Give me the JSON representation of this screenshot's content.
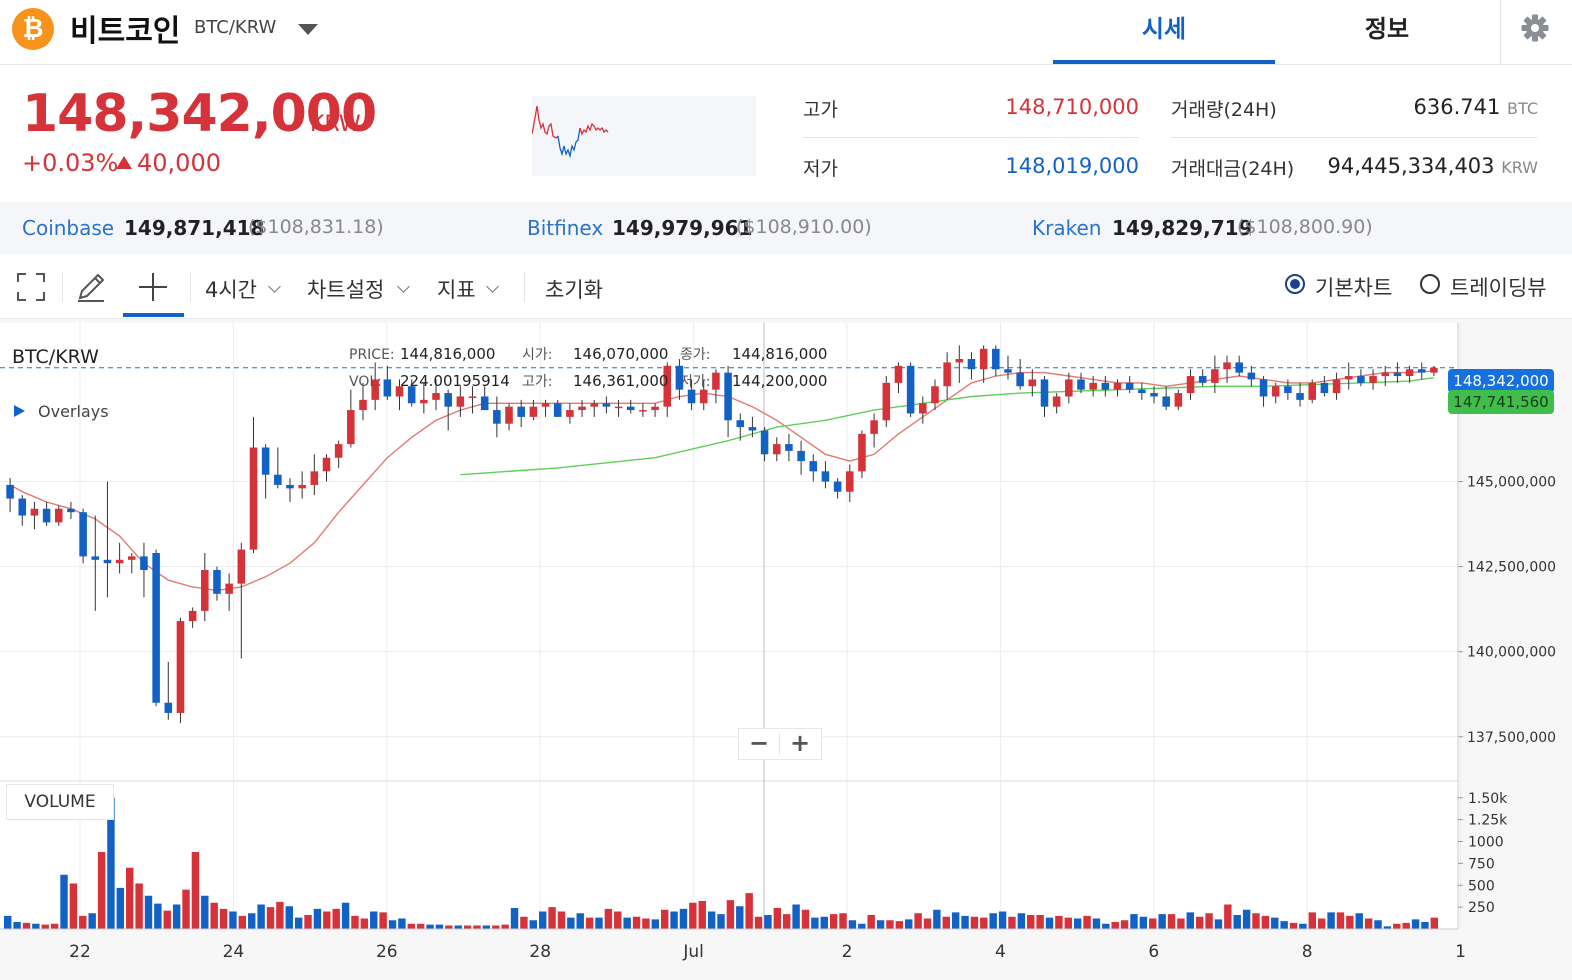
{
  "header": {
    "coin_symbol": "₿",
    "coin_name": "비트코인",
    "pair": "BTC/KRW",
    "tabs": [
      {
        "label": "시세",
        "active": true
      },
      {
        "label": "정보",
        "active": false
      }
    ],
    "settings_icon": "gear-icon"
  },
  "summary": {
    "price": "148,342,000",
    "unit": "KRW",
    "change_pct": "+0.03%",
    "change_abs": "40,000",
    "up_color": "#d6323a",
    "down_color": "#1261c4",
    "high_label": "고가",
    "high_value": "148,710,000",
    "low_label": "저가",
    "low_value": "148,019,000",
    "volume_label": "거래량(24H)",
    "volume_value": "636.741",
    "volume_unit": "BTC",
    "amount_label": "거래대금(24H)",
    "amount_value": "94,445,334,403",
    "amount_unit": "KRW"
  },
  "exchanges": [
    {
      "name": "Coinbase",
      "krw": "149,871,418",
      "usd": "($108,831.18)"
    },
    {
      "name": "Bitfinex",
      "krw": "149,979,961",
      "usd": "($108,910.00)"
    },
    {
      "name": "Kraken",
      "krw": "149,829,719",
      "usd": "($108,800.90)"
    }
  ],
  "toolbar": {
    "interval": "4시간",
    "chart_settings": "차트설정",
    "indicators": "지표",
    "reset": "초기화",
    "mode_basic": "기본차트",
    "mode_trading": "트레이딩뷰"
  },
  "chart_info": {
    "symbol": "BTC/KRW",
    "overlays": "Overlays",
    "price_label": "PRICE:",
    "price_value": "144,816,000",
    "open_label": "시가:",
    "open_value": "146,070,000",
    "close_label": "종가:",
    "close_value": "144,816,000",
    "vol_label": "VOL:",
    "vol_value": "224.00195914",
    "high_label": "고가:",
    "high_value": "146,361,000",
    "low_label": "저가:",
    "low_value": "144,200,000",
    "current_tag": "148,342,000",
    "ma_tag": "147,741,560",
    "volume_title": "VOLUME",
    "zoom_out": "−",
    "zoom_in": "+"
  },
  "chart_data": {
    "type": "candlestick",
    "price_axis": [
      145000000,
      142500000,
      140000000,
      137500000
    ],
    "price_axis_labels": [
      "145,000,000",
      "142,500,000",
      "140,000,000",
      "137,500,000"
    ],
    "volume_axis_labels": [
      "1.50k",
      "1.25k",
      "1000",
      "750",
      "500",
      "250"
    ],
    "x_axis_labels": [
      "22",
      "24",
      "26",
      "28",
      "Jul",
      "2",
      "4",
      "6",
      "8",
      "1"
    ],
    "ylim": [
      136200000,
      149600000
    ],
    "candles": [
      [
        144900000,
        145100000,
        144100000,
        144500000
      ],
      [
        144500000,
        144600000,
        143700000,
        144000000
      ],
      [
        144000000,
        144400000,
        143600000,
        144200000
      ],
      [
        144200000,
        144400000,
        143700000,
        143800000
      ],
      [
        143800000,
        144300000,
        143700000,
        144200000
      ],
      [
        144200000,
        144400000,
        143900000,
        144100000
      ],
      [
        144100000,
        144200000,
        142600000,
        142800000
      ],
      [
        142800000,
        144000000,
        141200000,
        142700000
      ],
      [
        142700000,
        145000000,
        141600000,
        142600000
      ],
      [
        142600000,
        143200000,
        142300000,
        142700000
      ],
      [
        142700000,
        142900000,
        142300000,
        142800000
      ],
      [
        142800000,
        143200000,
        141600000,
        142400000
      ],
      [
        142900000,
        143000000,
        138400000,
        138500000
      ],
      [
        138500000,
        139700000,
        138000000,
        138200000
      ],
      [
        138200000,
        141000000,
        137900000,
        140900000
      ],
      [
        140900000,
        141300000,
        140700000,
        141200000
      ],
      [
        141200000,
        142900000,
        140900000,
        142400000
      ],
      [
        142400000,
        142500000,
        141500000,
        141700000
      ],
      [
        141700000,
        142300000,
        141200000,
        142000000
      ],
      [
        142000000,
        143200000,
        139800000,
        143000000
      ],
      [
        143000000,
        146900000,
        142900000,
        146000000
      ],
      [
        146000000,
        146100000,
        144500000,
        145200000
      ],
      [
        145200000,
        146000000,
        144800000,
        144900000
      ],
      [
        144900000,
        145100000,
        144400000,
        144800000
      ],
      [
        144800000,
        145300000,
        144500000,
        144900000
      ],
      [
        144900000,
        145800000,
        144600000,
        145300000
      ],
      [
        145300000,
        145800000,
        145000000,
        145700000
      ],
      [
        145700000,
        146200000,
        145400000,
        146100000
      ],
      [
        146100000,
        147700000,
        146000000,
        147100000
      ],
      [
        147100000,
        147900000,
        146800000,
        147400000
      ],
      [
        147400000,
        148500000,
        147100000,
        148000000
      ],
      [
        148000000,
        148400000,
        147400000,
        147500000
      ],
      [
        147500000,
        148000000,
        147100000,
        147800000
      ],
      [
        147800000,
        148000000,
        147200000,
        147300000
      ],
      [
        147300000,
        147900000,
        147000000,
        147400000
      ],
      [
        147400000,
        148000000,
        147100000,
        147600000
      ],
      [
        147600000,
        147700000,
        146500000,
        147200000
      ],
      [
        147200000,
        147800000,
        146900000,
        147500000
      ],
      [
        147500000,
        147800000,
        147000000,
        147500000
      ],
      [
        147500000,
        147800000,
        147100000,
        147100000
      ],
      [
        147100000,
        147500000,
        146300000,
        146700000
      ],
      [
        146700000,
        147300000,
        146500000,
        147200000
      ],
      [
        147200000,
        147400000,
        146600000,
        146900000
      ],
      [
        146900000,
        147400000,
        146800000,
        147200000
      ],
      [
        147200000,
        147400000,
        146900000,
        147300000
      ],
      [
        147300000,
        147400000,
        146900000,
        146900000
      ],
      [
        146900000,
        147300000,
        146700000,
        147100000
      ],
      [
        147100000,
        147400000,
        146900000,
        147200000
      ],
      [
        147200000,
        147400000,
        146900000,
        147300000
      ],
      [
        147300000,
        147500000,
        147000000,
        147200000
      ],
      [
        147200000,
        147400000,
        146900000,
        147200000
      ],
      [
        147200000,
        147400000,
        147000000,
        147100000
      ],
      [
        147100000,
        147300000,
        146900000,
        147100000
      ],
      [
        147100000,
        147300000,
        146900000,
        147200000
      ],
      [
        147200000,
        148500000,
        146900000,
        148400000
      ],
      [
        148400000,
        148600000,
        147400000,
        147700000
      ],
      [
        147700000,
        148000000,
        147100000,
        147300000
      ],
      [
        147300000,
        148000000,
        147100000,
        147700000
      ],
      [
        147700000,
        148300000,
        147300000,
        148200000
      ],
      [
        148200000,
        148400000,
        146300000,
        146800000
      ],
      [
        146800000,
        147000000,
        146200000,
        146600000
      ],
      [
        146600000,
        146900000,
        146300000,
        146500000
      ],
      [
        146500000,
        146600000,
        145600000,
        145800000
      ],
      [
        145800000,
        146300000,
        145600000,
        146100000
      ],
      [
        146100000,
        146400000,
        145600000,
        145900000
      ],
      [
        145900000,
        146200000,
        145200000,
        145600000
      ],
      [
        145600000,
        145800000,
        145000000,
        145300000
      ],
      [
        145300000,
        145600000,
        144800000,
        145000000
      ],
      [
        145000000,
        145100000,
        144500000,
        144700000
      ],
      [
        144700000,
        145500000,
        144400000,
        145300000
      ],
      [
        145300000,
        146500000,
        145100000,
        146400000
      ],
      [
        146400000,
        147000000,
        146000000,
        146800000
      ],
      [
        146800000,
        148100000,
        146600000,
        147900000
      ],
      [
        147900000,
        148500000,
        147600000,
        148400000
      ],
      [
        148400000,
        148500000,
        146900000,
        147000000
      ],
      [
        147000000,
        147500000,
        146700000,
        147300000
      ],
      [
        147300000,
        148000000,
        147100000,
        147800000
      ],
      [
        147800000,
        148800000,
        147400000,
        148500000
      ],
      [
        148500000,
        149000000,
        147900000,
        148600000
      ],
      [
        148600000,
        148800000,
        148000000,
        148300000
      ],
      [
        148300000,
        149000000,
        147900000,
        148900000
      ],
      [
        148900000,
        149000000,
        148100000,
        148300000
      ],
      [
        148300000,
        148700000,
        148000000,
        148200000
      ],
      [
        148200000,
        148600000,
        147700000,
        147800000
      ],
      [
        147800000,
        148300000,
        147500000,
        148000000
      ],
      [
        148000000,
        148100000,
        146900000,
        147200000
      ],
      [
        147200000,
        147600000,
        147000000,
        147500000
      ],
      [
        147500000,
        148200000,
        147300000,
        148000000
      ],
      [
        148000000,
        148200000,
        147600000,
        147700000
      ],
      [
        147700000,
        148100000,
        147500000,
        147900000
      ],
      [
        147900000,
        148100000,
        147500000,
        147700000
      ],
      [
        147700000,
        148000000,
        147500000,
        147900000
      ],
      [
        147900000,
        148100000,
        147600000,
        147700000
      ],
      [
        147700000,
        147900000,
        147400000,
        147600000
      ],
      [
        147600000,
        147800000,
        147300000,
        147500000
      ],
      [
        147500000,
        147800000,
        147100000,
        147200000
      ],
      [
        147200000,
        147700000,
        147100000,
        147600000
      ],
      [
        147600000,
        148300000,
        147400000,
        148100000
      ],
      [
        148100000,
        148300000,
        147800000,
        147900000
      ],
      [
        147900000,
        148700000,
        147600000,
        148300000
      ],
      [
        148300000,
        148700000,
        147900000,
        148500000
      ],
      [
        148500000,
        148700000,
        148100000,
        148200000
      ],
      [
        148200000,
        148400000,
        147800000,
        148000000
      ],
      [
        148000000,
        148100000,
        147200000,
        147500000
      ],
      [
        147500000,
        147900000,
        147300000,
        147800000
      ],
      [
        147800000,
        148000000,
        147400000,
        147600000
      ],
      [
        147600000,
        147900000,
        147200000,
        147400000
      ],
      [
        147400000,
        148000000,
        147300000,
        147900000
      ],
      [
        147900000,
        148100000,
        147500000,
        147600000
      ],
      [
        147600000,
        148200000,
        147400000,
        148000000
      ],
      [
        148000000,
        148500000,
        147700000,
        148100000
      ],
      [
        148100000,
        148300000,
        147800000,
        147900000
      ],
      [
        147900000,
        148300000,
        147700000,
        148100000
      ],
      [
        148100000,
        148400000,
        147800000,
        148200000
      ],
      [
        148200000,
        148500000,
        147900000,
        148100000
      ],
      [
        148100000,
        148400000,
        147900000,
        148300000
      ],
      [
        148300000,
        148500000,
        148000000,
        148200000
      ],
      [
        148200000,
        148400000,
        148100000,
        148340000
      ]
    ],
    "volumes": [
      150,
      80,
      70,
      60,
      50,
      60,
      620,
      520,
      150,
      180,
      880,
      1500,
      470,
      700,
      520,
      380,
      290,
      210,
      280,
      450,
      880,
      380,
      300,
      230,
      200,
      150,
      180,
      280,
      250,
      310,
      260,
      130,
      160,
      230,
      200,
      230,
      300,
      150,
      120,
      200,
      190,
      100,
      120,
      60,
      60,
      50,
      50,
      40,
      40,
      40,
      40,
      40,
      40,
      50,
      240,
      140,
      100,
      200,
      250,
      200,
      130,
      180,
      130,
      130,
      230,
      200,
      130,
      140,
      120,
      110,
      220,
      200,
      230,
      300,
      320,
      200,
      170,
      330,
      260,
      410,
      140,
      160,
      240,
      170,
      280,
      220,
      130,
      140,
      170,
      180,
      100,
      60,
      160,
      100,
      100,
      90,
      110,
      180,
      120,
      220,
      140,
      190,
      150,
      140,
      130,
      180,
      200,
      140,
      180,
      160,
      160,
      130,
      150,
      130,
      120,
      150,
      120,
      60,
      80,
      100,
      170,
      140,
      120,
      170,
      170,
      120,
      190,
      140,
      180,
      110,
      280,
      160,
      220,
      180,
      150,
      130,
      90,
      70,
      60,
      190,
      120,
      190,
      190,
      150,
      180,
      120,
      100,
      30,
      60,
      70,
      110,
      80,
      130
    ],
    "ma_short": [
      [
        0,
        144900000
      ],
      [
        1,
        144700000
      ],
      [
        3,
        144400000
      ],
      [
        5,
        144200000
      ],
      [
        7,
        143900000
      ],
      [
        9,
        143400000
      ],
      [
        11,
        142600000
      ],
      [
        13,
        142100000
      ],
      [
        15,
        141900000
      ],
      [
        17,
        141800000
      ],
      [
        19,
        141900000
      ],
      [
        21,
        142200000
      ],
      [
        23,
        142600000
      ],
      [
        25,
        143200000
      ],
      [
        27,
        144100000
      ],
      [
        29,
        144900000
      ],
      [
        31,
        145700000
      ],
      [
        33,
        146300000
      ],
      [
        35,
        146800000
      ],
      [
        37,
        147100000
      ],
      [
        39,
        147300000
      ],
      [
        41,
        147300000
      ],
      [
        43,
        147300000
      ],
      [
        45,
        147300000
      ],
      [
        47,
        147300000
      ],
      [
        49,
        147300000
      ],
      [
        51,
        147300000
      ],
      [
        53,
        147300000
      ],
      [
        55,
        147500000
      ],
      [
        57,
        147600000
      ],
      [
        59,
        147500000
      ],
      [
        61,
        147200000
      ],
      [
        63,
        146800000
      ],
      [
        65,
        146300000
      ],
      [
        67,
        145800000
      ],
      [
        69,
        145600000
      ],
      [
        71,
        145800000
      ],
      [
        73,
        146400000
      ],
      [
        75,
        146900000
      ],
      [
        77,
        147400000
      ],
      [
        79,
        147900000
      ],
      [
        81,
        148100000
      ],
      [
        83,
        148200000
      ],
      [
        85,
        148200000
      ],
      [
        87,
        148100000
      ],
      [
        89,
        148000000
      ],
      [
        91,
        147900000
      ],
      [
        93,
        147900000
      ],
      [
        95,
        147800000
      ],
      [
        97,
        147900000
      ],
      [
        99,
        148000000
      ],
      [
        101,
        148100000
      ],
      [
        103,
        148000000
      ],
      [
        105,
        147900000
      ],
      [
        107,
        147900000
      ],
      [
        109,
        148000000
      ],
      [
        111,
        148100000
      ],
      [
        113,
        148200000
      ],
      [
        115,
        148200000
      ],
      [
        117,
        148250000
      ]
    ],
    "ma_long": [
      [
        37,
        145200000
      ],
      [
        45,
        145400000
      ],
      [
        53,
        145700000
      ],
      [
        59,
        146200000
      ],
      [
        63,
        146600000
      ],
      [
        67,
        146800000
      ],
      [
        71,
        147100000
      ],
      [
        75,
        147300000
      ],
      [
        79,
        147500000
      ],
      [
        83,
        147600000
      ],
      [
        87,
        147650000
      ],
      [
        91,
        147700000
      ],
      [
        95,
        147750000
      ],
      [
        99,
        147800000
      ],
      [
        103,
        147800000
      ],
      [
        107,
        147850000
      ],
      [
        111,
        147900000
      ],
      [
        115,
        147950000
      ],
      [
        117,
        148050000
      ]
    ]
  }
}
